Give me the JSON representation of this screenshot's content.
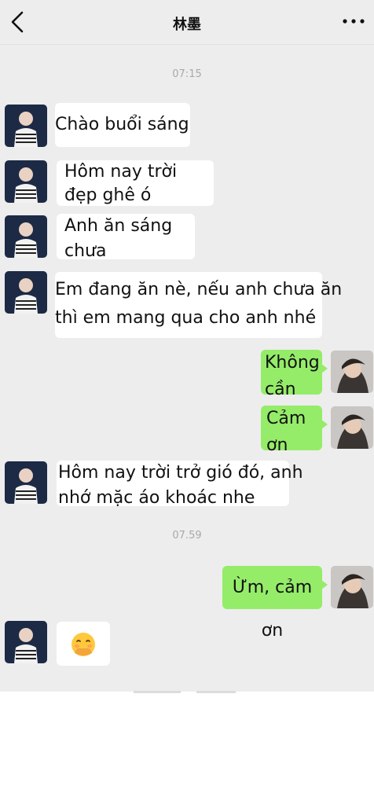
{
  "header": {
    "title": "林墨",
    "back_icon": "chevron-left-icon",
    "more_icon": "more-dots-icon"
  },
  "timestamps": [
    "07:15",
    "07.59"
  ],
  "messages": [
    {
      "side": "in",
      "text": "Chào buổi sáng"
    },
    {
      "side": "in",
      "text": "Hôm nay trời đẹp ghê ó"
    },
    {
      "side": "in",
      "text": "Anh ăn sáng chưa"
    },
    {
      "side": "in",
      "text": "Em đang ăn nè, nếu anh chưa ăn thì em mang qua cho anh nhé"
    },
    {
      "side": "out",
      "text": "Không cần"
    },
    {
      "side": "out",
      "text": "Cảm ơn"
    },
    {
      "side": "in",
      "text": "Hôm nay trời trở gió đó, anh nhớ mặc áo khoác nhe"
    },
    {
      "side": "out",
      "text": "Ừm, cảm ơn"
    },
    {
      "side": "in",
      "text": "",
      "icon": "smiling-face-with-hand-over-mouth-icon"
    }
  ],
  "colors": {
    "chat_bg": "#ededed",
    "incoming_bubble": "#ffffff",
    "outgoing_bubble": "#95ec69"
  }
}
